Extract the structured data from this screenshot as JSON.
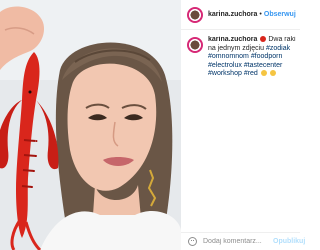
{
  "post": {
    "image_alt": "Woman holding a red crayfish next to her face"
  },
  "header": {
    "username": "karina.zuchora",
    "separator": "•",
    "follow_label": "Obserwuj"
  },
  "caption": {
    "username": "karina.zuchora",
    "text": "Dwa raki na jednym zdjęciu",
    "hashtags": [
      "#zodiak",
      "#omnomnom",
      "#foodporn",
      "#electrolux",
      "#tastecenter",
      "#workshop",
      "#red"
    ]
  },
  "comment_box": {
    "placeholder": "Dodaj komentarz...",
    "post_label": "Opublikuj"
  },
  "colors": {
    "link": "#3897f0",
    "hashtag": "#003569",
    "lobster": "#d9261c",
    "muted": "#8e8e8e"
  }
}
